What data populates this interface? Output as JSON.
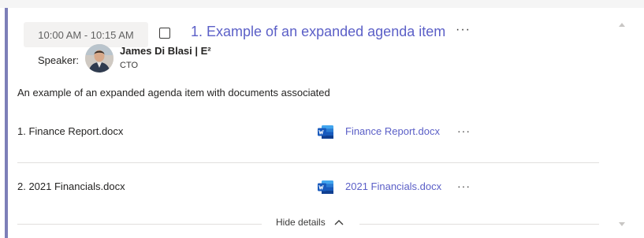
{
  "agenda_item": {
    "time": "10:00 AM - 10:15 AM",
    "title": "1. Example of an expanded agenda item",
    "more": "···",
    "speaker_label": "Speaker:",
    "speaker_name": "James Di Blasi | E²",
    "speaker_role": "CTO",
    "description": "An example of an expanded agenda item with documents associated"
  },
  "documents": [
    {
      "name": "1. Finance Report.docx",
      "link": "Finance Report.docx",
      "more": "···",
      "icon": "word-icon"
    },
    {
      "name": "2. 2021 Financials.docx",
      "link": "2021 Financials.docx",
      "more": "···",
      "icon": "word-icon"
    }
  ],
  "footer": {
    "hide_details": "Hide details"
  },
  "colors": {
    "accent": "#5b5fc7",
    "left_bar": "#7d7fb8",
    "word_blue": "#185abd"
  }
}
